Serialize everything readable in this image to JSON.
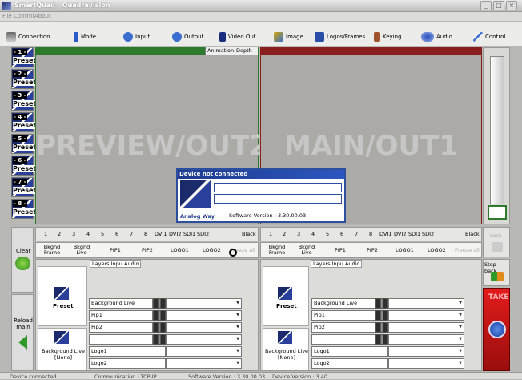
{
  "window": {
    "title": "SmartQuad - Quadravision",
    "minimize": "_",
    "maximize": "□",
    "close": "×"
  },
  "menu": [
    "File",
    "Control",
    "About"
  ],
  "toolbar": [
    "Connection",
    "Mode",
    "Input",
    "Output",
    "Video Out",
    "Image",
    "Logos/Frames",
    "Keying",
    "Audio",
    "Control"
  ],
  "presets": [
    {
      "num": "- 1 -",
      "label": "Preset"
    },
    {
      "num": "- 2 -",
      "label": "Preset"
    },
    {
      "num": "- 3 -",
      "label": "Preset"
    },
    {
      "num": "- 4 -",
      "label": "Preset"
    },
    {
      "num": "- 5 -",
      "label": "Preset"
    },
    {
      "num": "- 6 -",
      "label": "Preset"
    },
    {
      "num": "- 7 -",
      "label": "Preset"
    },
    {
      "num": "- 8 -",
      "label": "Preset"
    }
  ],
  "left_controls": {
    "clear": "Clear",
    "reload": "Reload main"
  },
  "preview": {
    "label": "PREVIEW/OUT2",
    "tabs": [
      "Animation",
      "Depth"
    ]
  },
  "main_screen": {
    "label": "MAIN/OUT1"
  },
  "source_buttons": [
    "1",
    "2",
    "3",
    "4",
    "5",
    "6",
    "7",
    "8",
    "DVI1",
    "DVI2",
    "SDI1",
    "SDI2"
  ],
  "black_label": "Black",
  "layer_targets": [
    "Bkgnd Frame",
    "Bkgnd Live",
    "PIP1",
    "PIP2",
    "LOGO1",
    "LOGO2"
  ],
  "freeze_label": "Freeze all",
  "panel_tabs": [
    "Layers Input",
    "Audio"
  ],
  "preset_label": "Preset",
  "bg_live": {
    "line1": "Background Live",
    "line2": "[None]"
  },
  "layers": [
    "Background Live",
    "Pip1",
    "Pip2",
    "",
    "Logo1",
    "Logo2"
  ],
  "right_col": {
    "lock": "Lock",
    "step_back": "Step back",
    "take": "TAKE"
  },
  "dialog": {
    "title": "Device not connected",
    "brand": "Analog Way",
    "version": "Software Version : 3.30.00.03"
  },
  "status": {
    "device": "Device connected",
    "comm": "Communication : TCP-IP",
    "sw": "Software Version : 3.30.00.03",
    "dev": "Device Version : 3.40"
  },
  "colors": {
    "preview_border": "#2d7a2d",
    "main_border": "#8a1f1f",
    "take": "#c31414",
    "dialog": "#2b4f9e"
  }
}
